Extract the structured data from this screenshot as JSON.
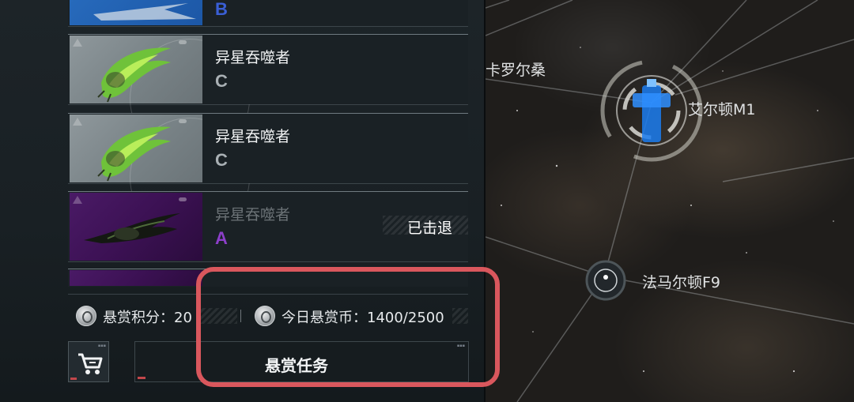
{
  "cards": [
    {
      "name": "",
      "grade": "B",
      "theme": "blue"
    },
    {
      "name": "异星吞噬者",
      "grade": "C",
      "theme": "grey"
    },
    {
      "name": "异星吞噬者",
      "grade": "C",
      "theme": "grey"
    },
    {
      "name": "异星吞噬者",
      "grade": "A",
      "theme": "purple",
      "status": "已击退"
    }
  ],
  "stats": {
    "bounty_points_label": "悬赏积分：20",
    "today_coins_label": "今日悬赏币：1400/2500"
  },
  "buttons": {
    "bounty_task": "悬赏任务"
  },
  "map": {
    "systems": [
      "卡罗尔桑",
      "艾尔顿M1",
      "法马尔顿F9"
    ]
  },
  "colors": {
    "highlight": "#d9575d",
    "grade_a": "#8c3fc9",
    "grade_b": "#3a5fd6",
    "station_blue": "#2f8fff"
  },
  "icons": [
    "medal-icon",
    "shopping-cart-icon",
    "warning-triangle-icon"
  ]
}
